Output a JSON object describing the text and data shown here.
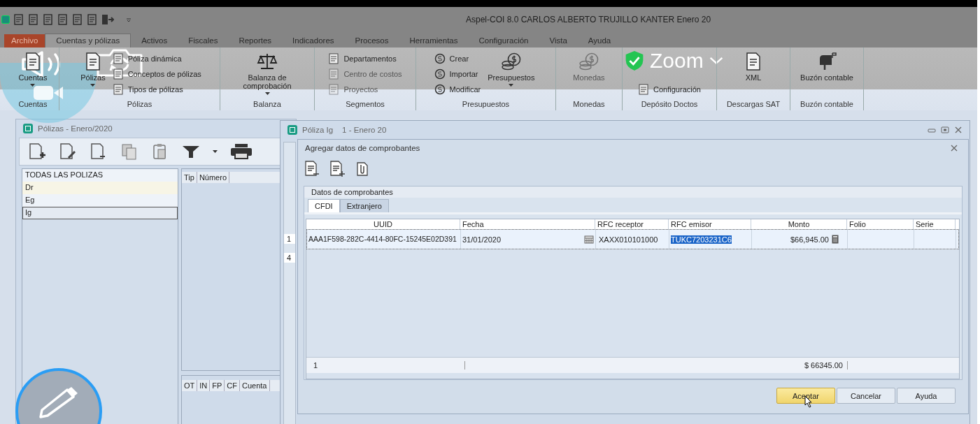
{
  "window": {
    "title": "Aspel-COI 8.0 CARLOS ALBERTO TRUJILLO KANTER Enero 20"
  },
  "menu_tabs": [
    {
      "label": "Archivo",
      "kind": "file",
      "selected": false
    },
    {
      "label": "Cuentas y pólizas",
      "kind": "tab",
      "selected": true
    },
    {
      "label": "Activos",
      "kind": "tab",
      "selected": false
    },
    {
      "label": "Fiscales",
      "kind": "tab",
      "selected": false
    },
    {
      "label": "Reportes",
      "kind": "tab",
      "selected": false
    },
    {
      "label": "Indicadores",
      "kind": "tab",
      "selected": false
    },
    {
      "label": "Procesos",
      "kind": "tab",
      "selected": false
    },
    {
      "label": "Herramientas",
      "kind": "tab",
      "selected": false
    },
    {
      "label": "Configuración",
      "kind": "tab",
      "selected": false
    },
    {
      "label": "Vista",
      "kind": "tab",
      "selected": false
    },
    {
      "label": "Ayuda",
      "kind": "tab",
      "selected": false
    }
  ],
  "ribbon_groups": [
    {
      "label": "Cuentas",
      "items": [
        {
          "kind": "large",
          "label": "Cuentas",
          "disabled": false,
          "dropdown": true
        }
      ]
    },
    {
      "label": "Pólizas",
      "items": [
        {
          "kind": "large",
          "label": "Pólizas",
          "disabled": false,
          "dropdown": true
        },
        {
          "kind": "small",
          "label": "Póliza dinámica",
          "disabled": false
        },
        {
          "kind": "small",
          "label": "Conceptos de pólizas",
          "disabled": false
        },
        {
          "kind": "small",
          "label": "Tipos de pólizas",
          "disabled": false
        }
      ]
    },
    {
      "label": "Balanza",
      "items": [
        {
          "kind": "large",
          "label": "Balanza de comprobación",
          "disabled": false,
          "dropdown": true
        }
      ]
    },
    {
      "label": "Segmentos",
      "items": [
        {
          "kind": "small",
          "label": "Departamentos",
          "disabled": false
        },
        {
          "kind": "small",
          "label": "Centro de costos",
          "disabled": true
        },
        {
          "kind": "small",
          "label": "Proyectos",
          "disabled": true
        }
      ]
    },
    {
      "label": "Presupuestos",
      "items": [
        {
          "kind": "small",
          "label": "Crear",
          "disabled": false
        },
        {
          "kind": "small",
          "label": "Importar",
          "disabled": false
        },
        {
          "kind": "small",
          "label": "Modificar",
          "disabled": false
        },
        {
          "kind": "large",
          "label": "Presupuestos",
          "disabled": false,
          "dropdown": true
        }
      ]
    },
    {
      "label": "Monedas",
      "items": [
        {
          "kind": "large",
          "label": "Monedas",
          "disabled": true,
          "dropdown": false
        }
      ]
    },
    {
      "label": "Depósito Doctos",
      "items": [
        {
          "kind": "small",
          "label": "Configuración",
          "disabled": false
        }
      ]
    },
    {
      "label": "Descargas SAT",
      "items": [
        {
          "kind": "large",
          "label": "XML",
          "disabled": false,
          "dropdown": false
        }
      ]
    },
    {
      "label": "Buzón contable",
      "items": [
        {
          "kind": "large",
          "label": "Buzón contable",
          "disabled": false,
          "dropdown": false
        }
      ]
    }
  ],
  "polizas_window": {
    "title": "Pólizas - Enero/2020",
    "types": [
      {
        "label": "TODAS LAS POLIZAS",
        "selected": false,
        "hovered": false
      },
      {
        "label": "Dr",
        "selected": false,
        "hovered": true
      },
      {
        "label": "Eg",
        "selected": false,
        "hovered": false
      },
      {
        "label": "Ig",
        "selected": true,
        "hovered": false
      }
    ],
    "list_columns": [
      "Tip",
      "Número"
    ],
    "detail_columns": [
      "OT",
      "IN",
      "FP",
      "CF",
      "Cuenta"
    ]
  },
  "poliza_window": {
    "title": "Póliza Ig",
    "subtitle": "1 - Enero 20",
    "row_numbers": [
      "1",
      "4"
    ]
  },
  "dialog": {
    "title": "Agregar datos de comprobantes",
    "section": "Datos de comprobantes",
    "tabs": [
      {
        "label": "CFDI",
        "selected": true
      },
      {
        "label": "Extranjero",
        "selected": false
      }
    ],
    "columns": [
      "UUID",
      "Fecha",
      "RFC receptor",
      "RFC emisor",
      "Monto",
      "Folio",
      "Serie"
    ],
    "rows": [
      {
        "selected": true,
        "cells": [
          {
            "text": "AAA1F598-282C-4414-80FC-15245E02D391",
            "highlighted": false
          },
          {
            "text": "31/01/2020",
            "highlighted": false
          },
          {
            "text": "XAXX010101000",
            "highlighted": false
          },
          {
            "text": "TUKC7203231C6",
            "highlighted": true
          },
          {
            "text": "$66,945.00",
            "highlighted": false
          }
        ]
      }
    ],
    "footer": {
      "count": "1",
      "total": "$ 66345.00"
    },
    "buttons": [
      {
        "label": "Aceptar",
        "default": true
      },
      {
        "label": "Cancelar",
        "default": false
      },
      {
        "label": "Ayuda",
        "default": false
      }
    ]
  },
  "overlay": {
    "label": "Zoom"
  }
}
